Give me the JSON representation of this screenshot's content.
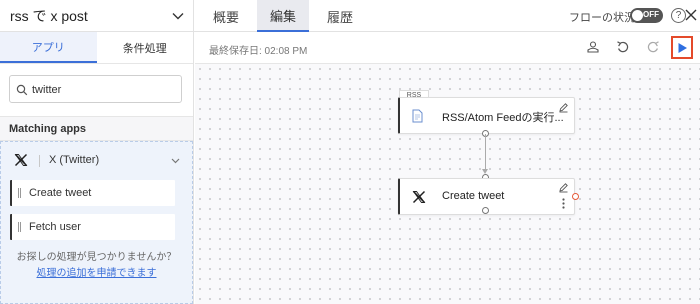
{
  "header": {
    "flow_title": "rss で x post",
    "tabs": [
      "概要",
      "編集",
      "履歴"
    ],
    "active_tab": "編集",
    "flow_status_label": "フローの状況",
    "toggle_state": "OFF",
    "help_label": "?"
  },
  "sidebar": {
    "tabs": [
      "アプリ",
      "条件処理"
    ],
    "active_tab": "アプリ",
    "search_value": "twitter",
    "search_placeholder": "",
    "section_title": "Matching apps",
    "app_name": "X (Twitter)",
    "actions": [
      "Create tweet",
      "Fetch user"
    ],
    "hint_text": "お探しの処理が見つかりませんか？",
    "hint_link": "処理の追加を申請できます"
  },
  "toolbar": {
    "last_saved": "最終保存日: 02:08 PM"
  },
  "canvas": {
    "nodes": [
      {
        "tag": "RSS",
        "label": "RSS/Atom Feedの実行..."
      },
      {
        "label": "Create tweet"
      }
    ]
  },
  "colors": {
    "accent": "#3b6fd8",
    "highlight": "#e44a2a",
    "toggle_off": "#555555"
  }
}
